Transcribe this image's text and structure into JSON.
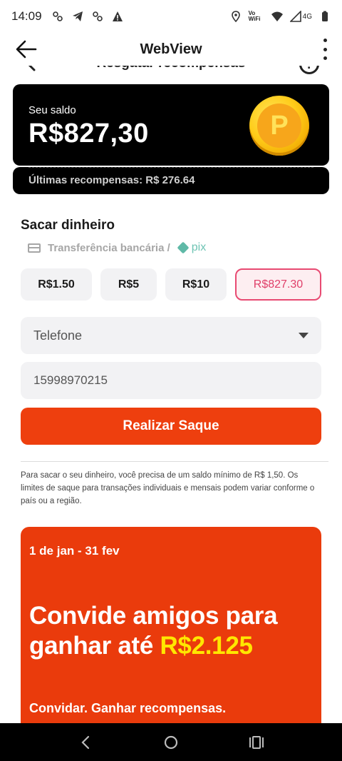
{
  "status_bar": {
    "time": "14:09",
    "wifi_label": "Vo WiFi",
    "network": "4G",
    "icons": [
      "notification-icon",
      "telegram-icon",
      "notification-icon",
      "warning-icon",
      "location-icon",
      "vowifi-icon",
      "wifi-icon",
      "signal-icon",
      "battery-icon"
    ]
  },
  "app_bar": {
    "title": "WebView"
  },
  "subheader": {
    "title": "Resgatar recompensas",
    "help_label": "?"
  },
  "balance": {
    "label": "Seu saldo",
    "value": "R$827,30",
    "coin_letter": "P",
    "recent": "Últimas recompensas: R$ 276.64"
  },
  "withdraw": {
    "title": "Sacar dinheiro",
    "method": "Transferência bancária /",
    "pix_label": "pix",
    "amounts": [
      {
        "label": "R$1.50",
        "selected": false
      },
      {
        "label": "R$5",
        "selected": false
      },
      {
        "label": "R$10",
        "selected": false
      },
      {
        "label": "R$827.30",
        "selected": true
      }
    ],
    "key_type": "Telefone",
    "phone_value": "15998970215",
    "submit_label": "Realizar Saque",
    "note": "Para sacar o seu dinheiro, você precisa de um saldo mínimo de R$ 1,50. Os limites de saque para transações individuais e mensais podem variar conforme o país ou a região."
  },
  "promo": {
    "dates": "1 de jan - 31 fev",
    "headline_line1": "Convide amigos para",
    "headline_line2": "ganhar até",
    "amount": "R$2.125",
    "cta": "Convidar. Ganhar recompensas."
  },
  "colors": {
    "accent": "#ee3f0e",
    "selected_pink": "#e84a72",
    "promo_highlight": "#ffe700",
    "card_black": "#000000"
  }
}
